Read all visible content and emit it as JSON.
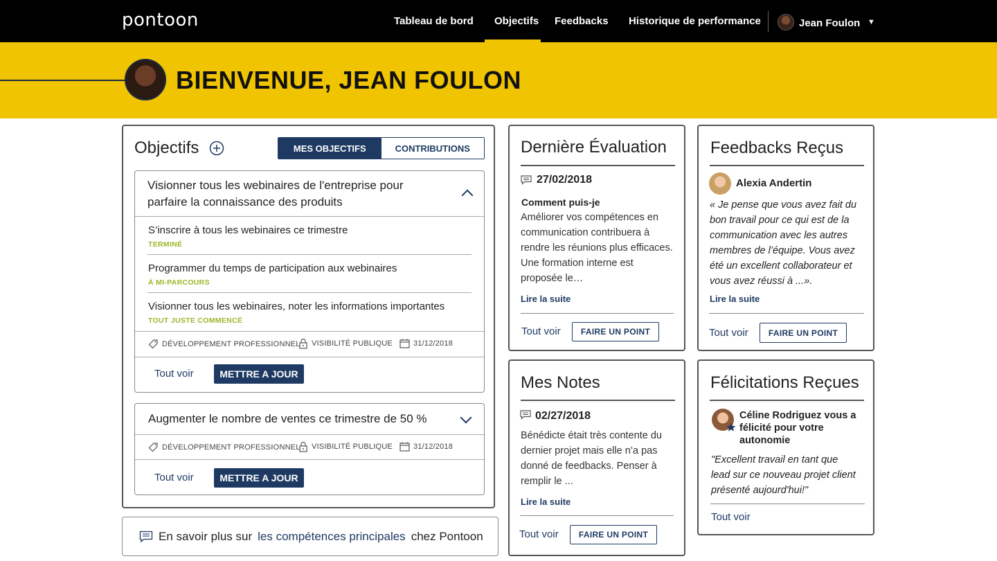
{
  "nav": {
    "logo": "pontoon",
    "links": [
      "Tableau de bord",
      "Objectifs",
      "Feedbacks",
      "Historique de performance"
    ],
    "active": "Objectifs",
    "user": "Jean Foulon",
    "caret": "▼"
  },
  "banner": {
    "title": "BIENVENUE, JEAN FOULON"
  },
  "objectifs": {
    "title": "Objectifs",
    "add_icon": "plus-circle-icon",
    "tabs": [
      "MES OBJECTIFS",
      "CONTRIBUTIONS"
    ],
    "goals": [
      {
        "title": "Visionner tous les webinaires de l'entreprise pour parfaire la connaissance des produits",
        "tasks": [
          {
            "title": "S’inscrire à tous les webinaires ce trimestre",
            "status": "TERMINÉ"
          },
          {
            "title": "Programmer du temps de participation aux webinaires",
            "status": "À MI-PARCOURS"
          },
          {
            "title": "Visionner tous les webinaires, noter les informations importantes",
            "status": "TOUT JUSTE COMMENCÉ"
          }
        ],
        "category": "DÉVELOPPEMENT PROFESSIONNEL",
        "visibility": "VISIBILITÉ PUBLIQUE",
        "date": "31/12/2018",
        "see_all": "Tout voir",
        "update": "METTRE A JOUR"
      },
      {
        "title": "Augmenter le nombre de ventes ce trimestre de 50 %",
        "category": "DÉVELOPPEMENT PROFESSIONNEL",
        "visibility": "VISIBILITÉ PUBLIQUE",
        "date": "31/12/2018",
        "see_all": "Tout voir",
        "update": "METTRE A JOUR"
      }
    ]
  },
  "evaluation": {
    "title": "Dernière Évaluation",
    "date": "27/02/2018",
    "subtitle": "Comment puis-je",
    "text": "Améliorer vos compétences en communication contribuera à rendre les réunions plus efficaces. Une formation interne est proposée le…",
    "read_more": "Lire la suite",
    "see_all": "Tout voir",
    "button": "FAIRE UN POINT"
  },
  "feedbacks": {
    "title": "Feedbacks Reçus",
    "author": "Alexia Andertin",
    "quote": "« Je pense que vous avez fait du bon travail pour ce qui est de la communication avec les autres membres de l’équipe. Vous avez été un excellent collaborateur et vous avez réussi à ...».",
    "read_more": "Lire la suite",
    "see_all": "Tout voir",
    "button": "FAIRE UN POINT"
  },
  "notes": {
    "title": "Mes Notes",
    "date": "02/27/2018",
    "text": "Bénédicte était très contente du dernier projet mais elle n’a pas donné de feedbacks. Penser à remplir le ...",
    "read_more": "Lire la suite",
    "see_all": "Tout voir",
    "button": "FAIRE UN POINT"
  },
  "felicitations": {
    "title": "Félicitations Reçues",
    "headline": "Céline Rodriguez vous a félicité pour votre autonomie",
    "quote": "\"Excellent travail en tant que lead sur ce nouveau projet client présenté aujourd'hui!\"",
    "see_all": "Tout voir"
  },
  "footer": {
    "prefix": "En savoir plus sur",
    "link": "les compétences principales",
    "suffix": "chez Pontoon"
  },
  "colors": {
    "brand_navy": "#1e3a62",
    "banner_yellow": "#f0c400",
    "status_green": "#9ab82a"
  }
}
